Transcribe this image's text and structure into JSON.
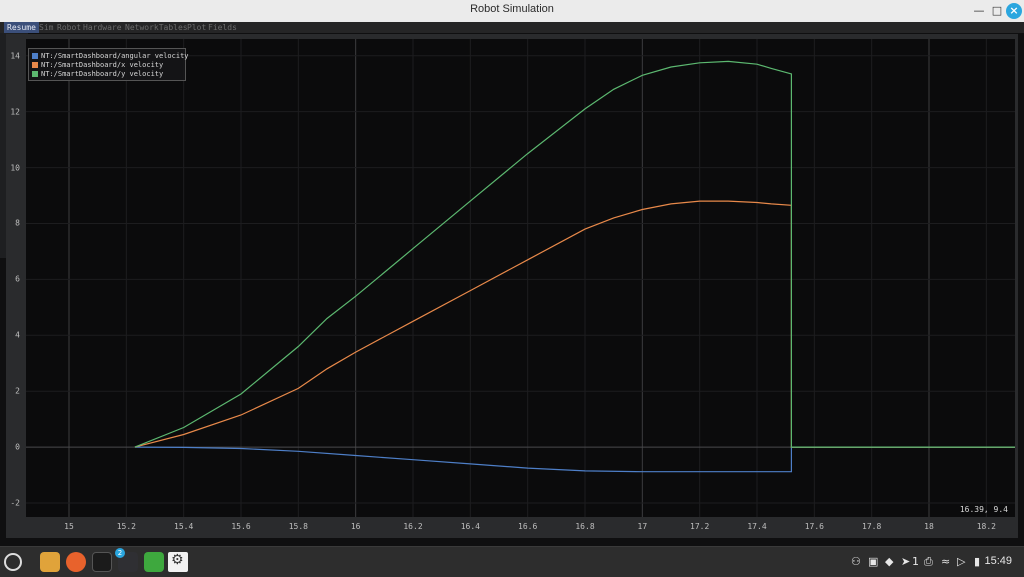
{
  "window": {
    "title": "Robot Simulation"
  },
  "menubar": {
    "items": [
      "Resume",
      "Sim",
      "Robot",
      "Hardware",
      "NetworkTables",
      "Plot",
      "Fields"
    ]
  },
  "plot": {
    "coord_readout": "16.39, 9.4",
    "legend": [
      {
        "label": "NT:/SmartDashboard/angular velocity",
        "color": "#4e7fc8"
      },
      {
        "label": "NT:/SmartDashboard/x velocity",
        "color": "#e8894a"
      },
      {
        "label": "NT:/SmartDashboard/y velocity",
        "color": "#5cb870"
      }
    ]
  },
  "chart_data": {
    "type": "line",
    "title": "",
    "xlabel": "",
    "ylabel": "",
    "xlim": [
      14.85,
      18.3
    ],
    "ylim": [
      -2.5,
      14.6
    ],
    "xticks": [
      "15",
      "15.2",
      "15.4",
      "15.6",
      "15.8",
      "16",
      "16.2",
      "16.4",
      "16.6",
      "16.8",
      "17",
      "17.2",
      "17.4",
      "17.6",
      "17.8",
      "18",
      "18.2"
    ],
    "yticks": [
      "-2",
      "0",
      "2",
      "4",
      "6",
      "8",
      "10",
      "12",
      "14"
    ],
    "grid": true,
    "legend_position": "top-left",
    "series": [
      {
        "name": "NT:/SmartDashboard/angular velocity",
        "color": "#4e7fc8",
        "x": [
          15.23,
          15.4,
          15.6,
          15.8,
          16.0,
          16.2,
          16.4,
          16.6,
          16.8,
          17.0,
          17.2,
          17.4,
          17.52,
          17.52,
          18.3
        ],
        "y": [
          0.0,
          -0.01,
          -0.05,
          -0.15,
          -0.3,
          -0.45,
          -0.6,
          -0.75,
          -0.85,
          -0.88,
          -0.88,
          -0.88,
          -0.88,
          0.0,
          0.0
        ]
      },
      {
        "name": "NT:/SmartDashboard/x velocity",
        "color": "#e8894a",
        "x": [
          15.23,
          15.4,
          15.6,
          15.8,
          15.9,
          16.0,
          16.2,
          16.4,
          16.6,
          16.8,
          16.9,
          17.0,
          17.1,
          17.2,
          17.3,
          17.4,
          17.45,
          17.52,
          17.52,
          18.3
        ],
        "y": [
          0.0,
          0.45,
          1.15,
          2.1,
          2.8,
          3.4,
          4.5,
          5.6,
          6.7,
          7.8,
          8.2,
          8.5,
          8.7,
          8.8,
          8.8,
          8.75,
          8.7,
          8.65,
          0.0,
          0.0
        ]
      },
      {
        "name": "NT:/SmartDashboard/y velocity",
        "color": "#5cb870",
        "x": [
          15.23,
          15.4,
          15.6,
          15.8,
          15.9,
          16.0,
          16.2,
          16.4,
          16.6,
          16.8,
          16.9,
          17.0,
          17.1,
          17.2,
          17.3,
          17.4,
          17.45,
          17.52,
          17.52,
          18.3
        ],
        "y": [
          0.0,
          0.7,
          1.9,
          3.6,
          4.6,
          5.4,
          7.1,
          8.8,
          10.5,
          12.1,
          12.8,
          13.3,
          13.6,
          13.75,
          13.8,
          13.7,
          13.55,
          13.35,
          0.0,
          0.0
        ]
      }
    ]
  },
  "taskbar": {
    "clock": "15:49",
    "notification_count": "2",
    "workspace_number": "1"
  }
}
